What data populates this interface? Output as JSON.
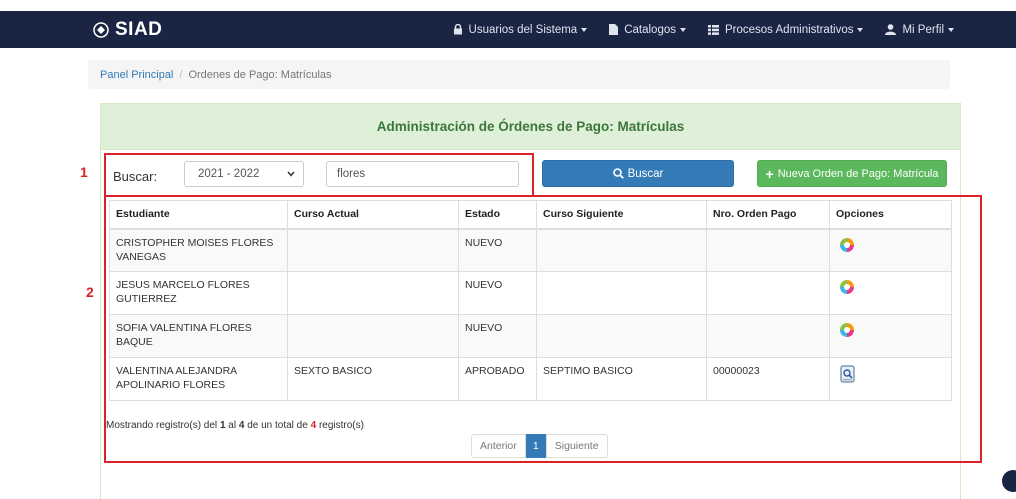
{
  "app": {
    "brand": "SIAD"
  },
  "nav": {
    "items": [
      {
        "label": "Usuarios del Sistema",
        "icon": "lock-icon"
      },
      {
        "label": "Catalogos",
        "icon": "file-icon"
      },
      {
        "label": "Procesos Administrativos",
        "icon": "list-icon"
      },
      {
        "label": "Mi Perfil",
        "icon": "user-icon"
      }
    ]
  },
  "breadcrumb": {
    "home": "Panel Principal",
    "separator": "/",
    "current": "Ordenes de Pago: Matrículas"
  },
  "panel": {
    "title": "Administración de Órdenes de Pago: Matrículas"
  },
  "annotations": {
    "box1": "1",
    "box2": "2"
  },
  "search": {
    "label": "Buscar:",
    "period": "2021 - 2022",
    "query": "flores",
    "button": "Buscar",
    "new_button": "Nueva Orden de Pago: Matrícula"
  },
  "table": {
    "headers": [
      "Estudiante",
      "Curso Actual",
      "Estado",
      "Curso Siguiente",
      "Nro. Orden Pago",
      "Opciones"
    ],
    "rows": [
      {
        "estudiante": "CRISTOPHER MOISES FLORES VANEGAS",
        "curso_actual": "",
        "estado": "NUEVO",
        "curso_siguiente": "",
        "orden": ""
      },
      {
        "estudiante": "JESUS MARCELO FLORES GUTIERREZ",
        "curso_actual": "",
        "estado": "NUEVO",
        "curso_siguiente": "",
        "orden": ""
      },
      {
        "estudiante": "SOFIA VALENTINA FLORES BAQUE",
        "curso_actual": "",
        "estado": "NUEVO",
        "curso_siguiente": "",
        "orden": ""
      },
      {
        "estudiante": "VALENTINA ALEJANDRA APOLINARIO FLORES",
        "curso_actual": "SEXTO BASICO",
        "estado": "APROBADO",
        "curso_siguiente": "SEPTIMO BASICO",
        "orden": "00000023"
      }
    ]
  },
  "footer": {
    "prefix": "Mostrando registro(s) del",
    "from": "1",
    "mid": "al",
    "to": "4",
    "mid2": "de un total de",
    "total": "4",
    "suffix": "registro(s)"
  },
  "pagination": {
    "prev": "Anterior",
    "page": "1",
    "next": "Siguiente"
  },
  "colors": {
    "navbar": "#1a2544",
    "panel_header": "#dff0d8",
    "primary": "#337ab7",
    "success": "#5cb85c",
    "annotation": "#d9222a"
  }
}
